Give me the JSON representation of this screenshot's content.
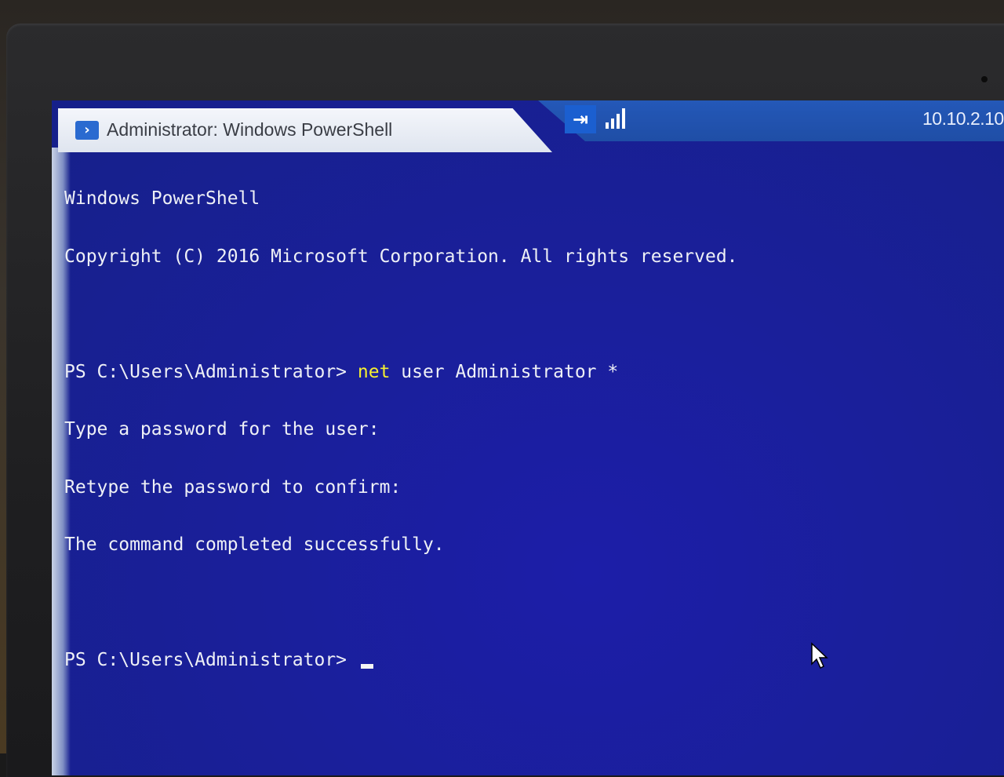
{
  "window": {
    "title": "Administrator: Windows PowerShell",
    "icon": "powershell-icon"
  },
  "rdp_bar": {
    "host": "10.10.2.10",
    "pin_icon": "pin-icon",
    "signal_icon": "signal-strength-icon"
  },
  "console": {
    "banner": [
      "Windows PowerShell",
      "Copyright (C) 2016 Microsoft Corporation. All rights reserved."
    ],
    "prompt": "PS C:\\Users\\Administrator> ",
    "command_keyword": "net",
    "command_args": " user Administrator *",
    "output": [
      "Type a password for the user:",
      "Retype the password to confirm:",
      "The command completed successfully."
    ],
    "current_prompt": "PS C:\\Users\\Administrator> "
  },
  "colors": {
    "console_background": "#1a1f9a",
    "console_text": "#eef0f6",
    "command_highlight": "#f5ef30",
    "rdp_bar": "#2458b8"
  }
}
